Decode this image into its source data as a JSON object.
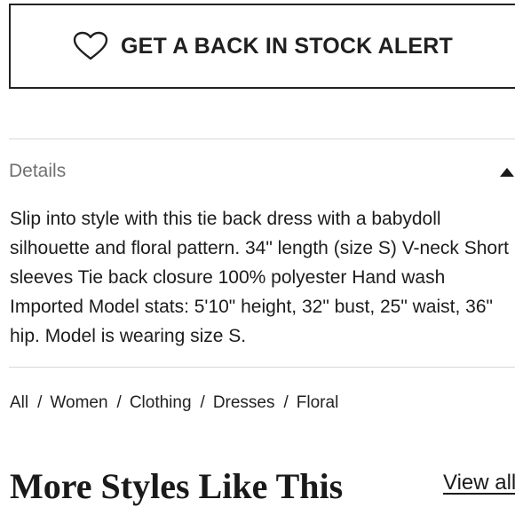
{
  "alert_button": {
    "label": "GET A BACK IN STOCK ALERT",
    "icon": "heart-outline-icon"
  },
  "details": {
    "title": "Details",
    "toggle_icon": "caret-up-icon",
    "expanded": true,
    "description": "Slip into style with this tie back dress with a babydoll silhouette and floral pattern. 34\" length (size S) V-neck Short sleeves Tie back closure 100% polyester Hand wash Imported Model stats: 5'10\" height, 32\" bust, 25\" waist, 36\" hip. Model is wearing size S."
  },
  "breadcrumb": {
    "separator": "/",
    "items": [
      {
        "label": "All"
      },
      {
        "label": "Women"
      },
      {
        "label": "Clothing"
      },
      {
        "label": "Dresses"
      },
      {
        "label": "Floral"
      }
    ]
  },
  "more_styles": {
    "heading": "More Styles Like This",
    "view_all_label": "View all"
  },
  "colors": {
    "text": "#222222",
    "muted": "#707070",
    "divider": "#d9d9d9",
    "background": "#ffffff"
  }
}
